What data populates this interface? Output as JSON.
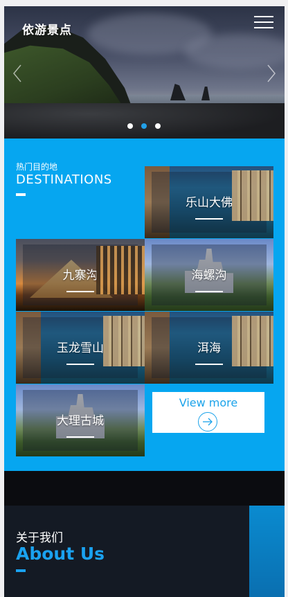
{
  "header": {
    "logo": "依游景点",
    "menu_icon": "hamburger-icon"
  },
  "hero": {
    "prev_icon": "chevron-left-icon",
    "next_icon": "chevron-right-icon",
    "slide_count": 3,
    "active_slide": 2
  },
  "destinations": {
    "title_cn": "热门目的地",
    "title_en": "DESTINATIONS",
    "items": [
      {
        "label": "乐山大佛"
      },
      {
        "label": "九寨沟"
      },
      {
        "label": "海螺沟"
      },
      {
        "label": "玉龙雪山"
      },
      {
        "label": "洱海"
      },
      {
        "label": "大理古城"
      }
    ],
    "view_more": {
      "label": "View more",
      "icon": "arrow-right-circle-icon"
    }
  },
  "about": {
    "title_cn": "关于我们",
    "title_en": "About Us"
  },
  "colors": {
    "accent": "#06a6f0",
    "about_accent": "#1aa2f0",
    "dark": "#0b0c10"
  }
}
